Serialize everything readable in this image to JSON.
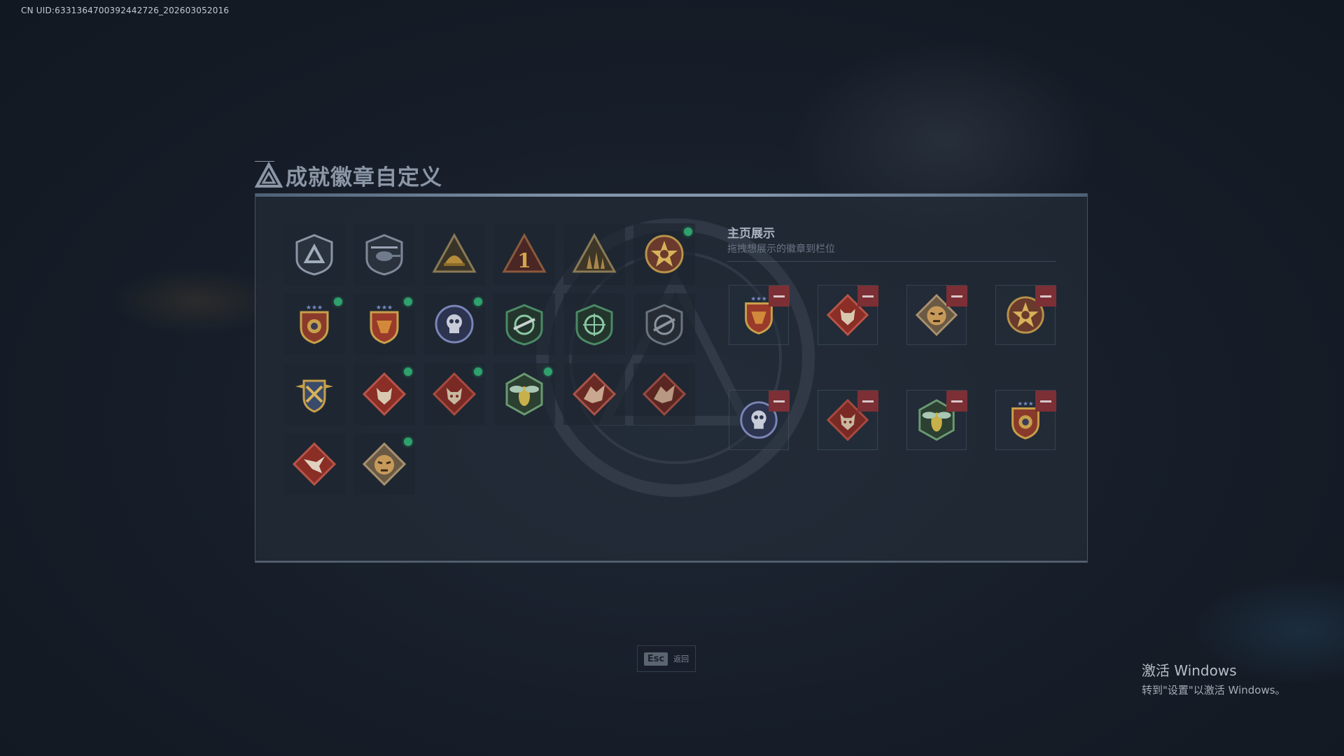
{
  "uid_label": "CN UID:633136470039244272​6_202603052016",
  "page_title": "成就徽章自定义",
  "showcase": {
    "title": "主页展示",
    "subtitle": "拖拽想展示的徽章到栏位"
  },
  "badges": [
    {
      "icon": "triangle-shield-badge-icon",
      "new": false
    },
    {
      "icon": "helicopter-badge-icon",
      "new": false
    },
    {
      "icon": "helmet-triangle-badge-icon",
      "new": false
    },
    {
      "icon": "number-one-badge-icon",
      "new": false
    },
    {
      "icon": "soldiers-triangle-badge-icon",
      "new": false
    },
    {
      "icon": "star-wreath-badge-icon",
      "new": true
    },
    {
      "icon": "crest-stars-badge-icon",
      "new": true
    },
    {
      "icon": "crest-red-badge-icon",
      "new": true
    },
    {
      "icon": "skull-round-badge-icon",
      "new": true
    },
    {
      "icon": "crosshair-green-badge-icon",
      "new": false
    },
    {
      "icon": "crosshair-gun-badge-icon",
      "new": false
    },
    {
      "icon": "gun-dark-badge-icon",
      "new": false
    },
    {
      "icon": "wings-shield-badge-icon",
      "new": false
    },
    {
      "icon": "wolf-diamond-badge-icon",
      "new": true
    },
    {
      "icon": "wolf-diamond-alt-badge-icon",
      "new": true
    },
    {
      "icon": "hornet-badge-icon",
      "new": true
    },
    {
      "icon": "dragon-diamond-badge-icon",
      "new": false
    },
    {
      "icon": "dragon-diamond-alt-badge-icon",
      "new": false
    },
    {
      "icon": "bird-diamond-badge-icon",
      "new": false
    },
    {
      "icon": "tiger-badge-icon",
      "new": true
    }
  ],
  "showcase_slots": [
    {
      "icon": "crest-red-badge-icon"
    },
    {
      "icon": "wolf-diamond-badge-icon"
    },
    {
      "icon": "tiger-badge-icon"
    },
    {
      "icon": "star-wreath-badge-icon"
    },
    {
      "icon": "skull-round-badge-icon"
    },
    {
      "icon": "wolf-diamond-alt-badge-icon"
    },
    {
      "icon": "hornet-badge-icon"
    },
    {
      "icon": "crest-stars-badge-icon"
    }
  ],
  "footer": {
    "esc_key": "Esc",
    "esc_label": "返回"
  },
  "windows_activation": {
    "line1": "激活 Windows",
    "line2": "转到\"设置\"以激活 Windows。"
  },
  "colors": {
    "new_dot": "#2fa16d",
    "remove_button": "#7c2f34"
  }
}
